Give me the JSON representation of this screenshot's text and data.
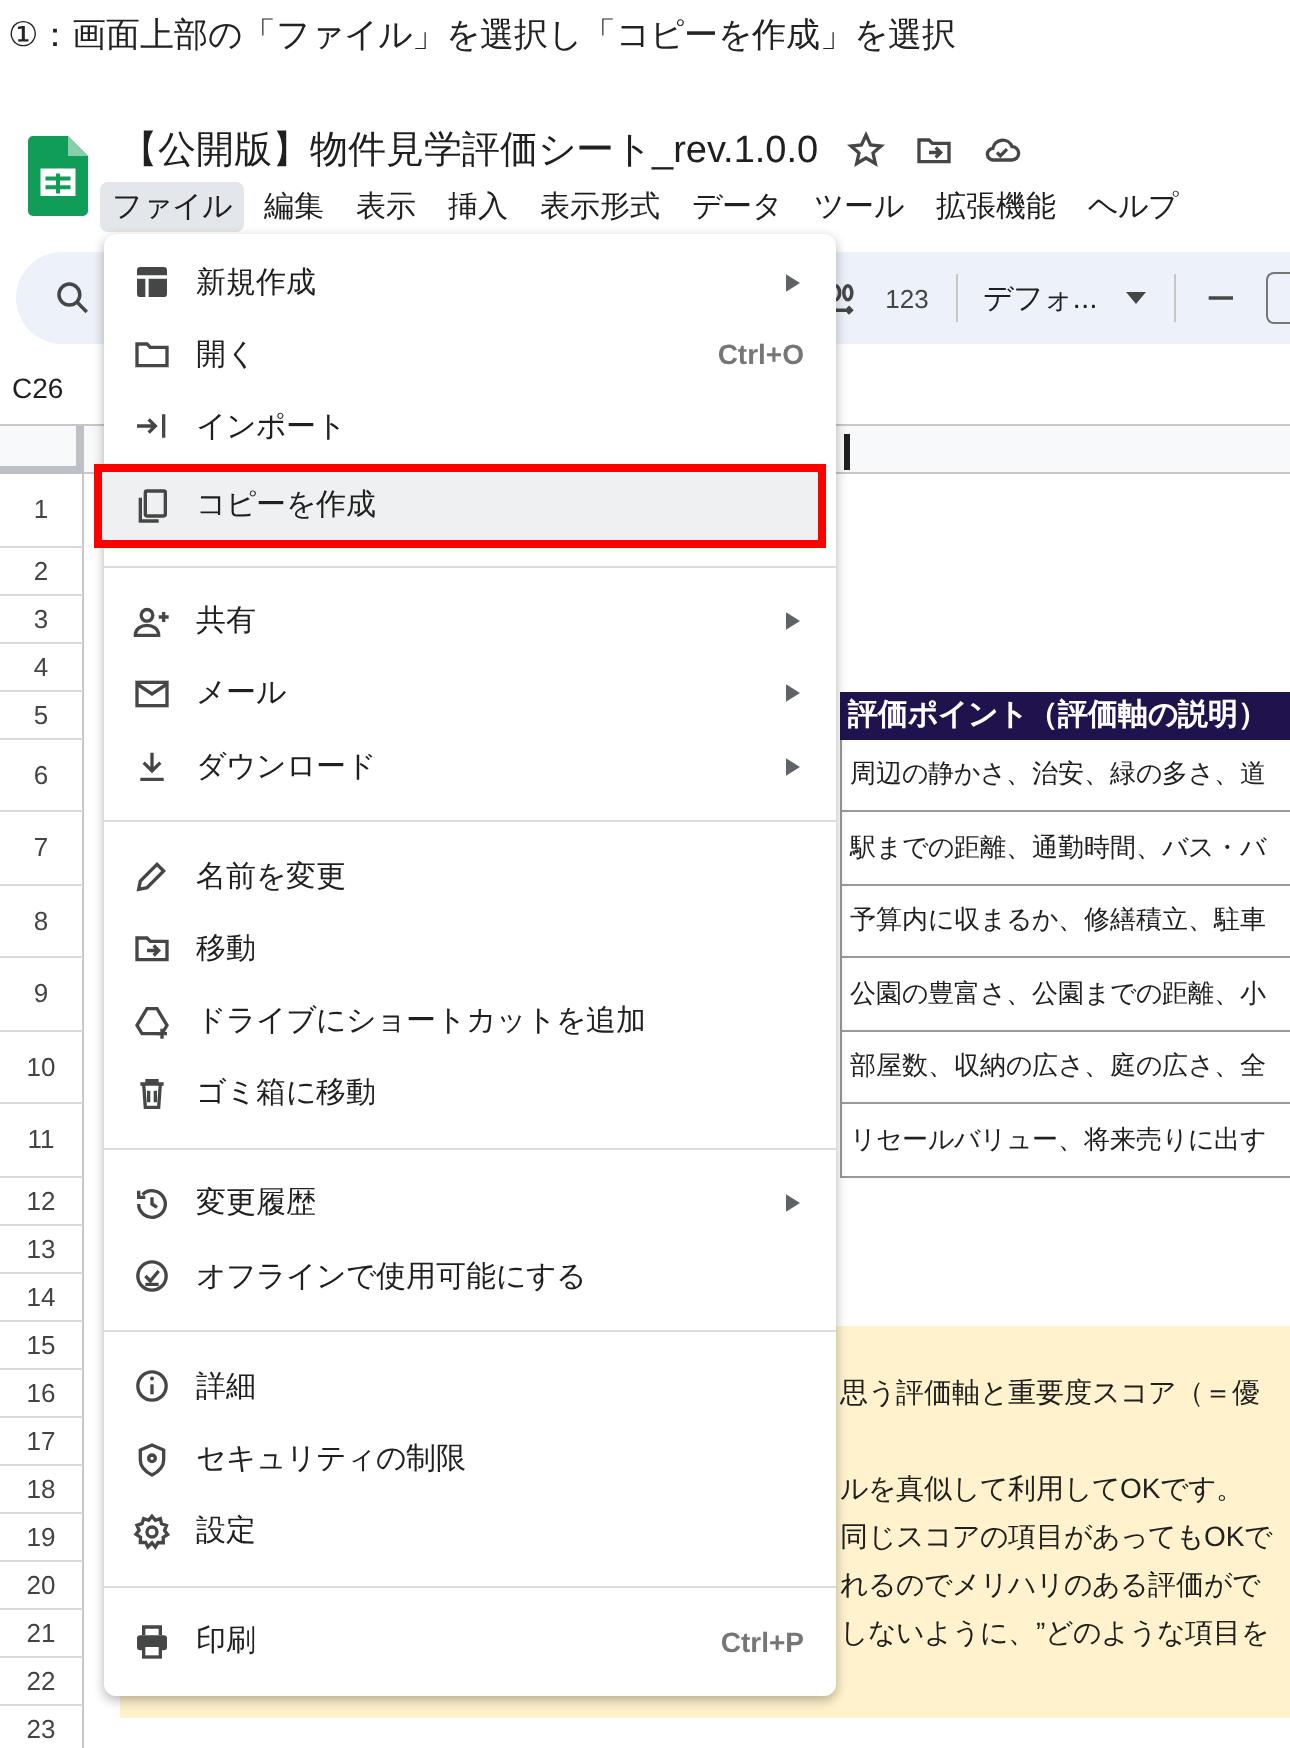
{
  "caption": "①：画面上部の「ファイル」を選択し「コピーを作成」を選択",
  "document": {
    "title": "【公開版】物件見学評価シート_rev.1.0.0"
  },
  "menu_bar": [
    {
      "label": "ファイル",
      "selected": true
    },
    {
      "label": "編集",
      "selected": false
    },
    {
      "label": "表示",
      "selected": false
    },
    {
      "label": "挿入",
      "selected": false
    },
    {
      "label": "表示形式",
      "selected": false
    },
    {
      "label": "データ",
      "selected": false
    },
    {
      "label": "ツール",
      "selected": false
    },
    {
      "label": "拡張機能",
      "selected": false
    },
    {
      "label": "ヘルプ",
      "selected": false
    }
  ],
  "toolbar": {
    "number_format": "123",
    "font": "デフォ..."
  },
  "name_box": "C26",
  "sheet": {
    "row_numbers": [
      "1",
      "2",
      "3",
      "4",
      "5",
      "6",
      "7",
      "8",
      "9",
      "10",
      "11",
      "12",
      "13",
      "14",
      "15",
      "16",
      "17",
      "18",
      "19",
      "20",
      "21",
      "22",
      "23"
    ],
    "table": {
      "header": "評価ポイント（評価軸の説明）",
      "rows": [
        "周辺の静かさ、治安、緑の多さ、道",
        "駅までの距離、通勤時間、バス・バ",
        "予算内に収まるか、修繕積立、駐車",
        "公園の豊富さ、公園までの距離、小",
        "部屋数、収納の広さ、庭の広さ、全",
        "リセールバリュー、将来売りに出す"
      ]
    },
    "note_lines": [
      "思う評価軸と重要度スコア（＝優",
      "ルを真似して利用してOKです。",
      "同じスコアの項目があってもOKで",
      "れるのでメリハリのある評価がで",
      "しないように、”どのような項目を"
    ]
  },
  "file_menu": {
    "groups": [
      [
        {
          "label": "新規作成",
          "submenu": true,
          "selected": false
        },
        {
          "label": "開く",
          "shortcut": "Ctrl+O",
          "submenu": false,
          "selected": false
        },
        {
          "label": "インポート",
          "submenu": false,
          "selected": false
        },
        {
          "label": "コピーを作成",
          "submenu": false,
          "selected": true
        }
      ],
      [
        {
          "label": "共有",
          "submenu": true,
          "selected": false
        },
        {
          "label": "メール",
          "submenu": true,
          "selected": false
        },
        {
          "label": "ダウンロード",
          "submenu": true,
          "selected": false
        }
      ],
      [
        {
          "label": "名前を変更",
          "submenu": false,
          "selected": false
        },
        {
          "label": "移動",
          "submenu": false,
          "selected": false
        },
        {
          "label": "ドライブにショートカットを追加",
          "submenu": false,
          "selected": false
        },
        {
          "label": "ゴミ箱に移動",
          "submenu": false,
          "selected": false
        }
      ],
      [
        {
          "label": "変更履歴",
          "submenu": true,
          "selected": false
        },
        {
          "label": "オフラインで使用可能にする",
          "submenu": false,
          "selected": false
        }
      ],
      [
        {
          "label": "詳細",
          "submenu": false,
          "selected": false
        },
        {
          "label": "セキュリティの制限",
          "submenu": false,
          "selected": false
        },
        {
          "label": "設定",
          "submenu": false,
          "selected": false
        }
      ],
      [
        {
          "label": "印刷",
          "shortcut": "Ctrl+P",
          "submenu": false,
          "selected": false
        }
      ]
    ]
  }
}
